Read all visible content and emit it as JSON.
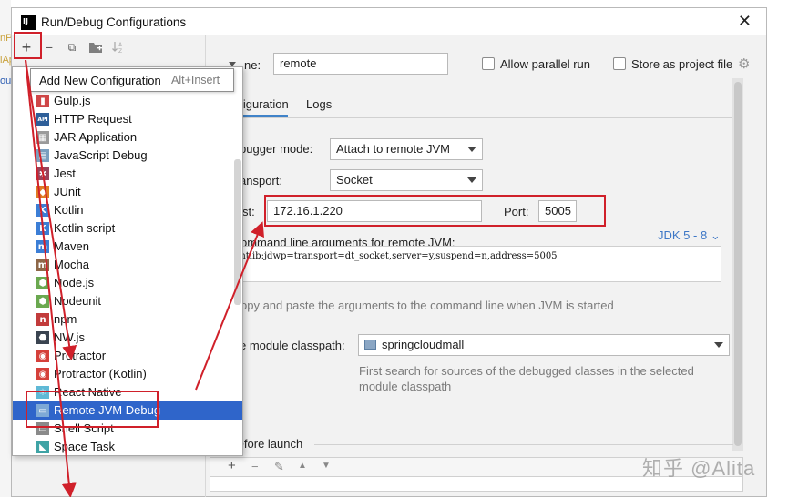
{
  "window": {
    "title": "Run/Debug Configurations",
    "close": "✕"
  },
  "edge_text": [
    "nPo",
    "lAp",
    "oul"
  ],
  "toolbar": {
    "add": "+",
    "remove": "−",
    "copy": "⧉",
    "folder": "▸",
    "sort": "↓"
  },
  "tooltip": {
    "title": "Add New Configuration",
    "shortcut": "Alt+Insert"
  },
  "config_types": [
    {
      "label": "Gulp.js",
      "icon": "gulp-icon",
      "icon_char": "▮",
      "color": "#cf4647"
    },
    {
      "label": "HTTP Request",
      "icon": "api-icon",
      "icon_char": "API",
      "color": "#2e5f99"
    },
    {
      "label": "JAR Application",
      "icon": "jar-icon",
      "icon_char": "▦",
      "color": "#9a9a9a"
    },
    {
      "label": "JavaScript Debug",
      "icon": "js-debug-icon",
      "icon_char": "▤",
      "color": "#7a9fbf"
    },
    {
      "label": "Jest",
      "icon": "jest-icon",
      "icon_char": "✱",
      "color": "#99425b"
    },
    {
      "label": "JUnit",
      "icon": "junit-icon",
      "icon_char": "◆",
      "color": "#e07b22"
    },
    {
      "label": "Kotlin",
      "icon": "kotlin-icon",
      "icon_char": "K",
      "color": "#3b7ed6"
    },
    {
      "label": "Kotlin script",
      "icon": "kotlin-script-icon",
      "icon_char": "K",
      "color": "#3b7ed6"
    },
    {
      "label": "Maven",
      "icon": "maven-icon",
      "icon_char": "m",
      "color": "#3b7ed6"
    },
    {
      "label": "Mocha",
      "icon": "mocha-icon",
      "icon_char": "m",
      "color": "#8d6748"
    },
    {
      "label": "Node.js",
      "icon": "nodejs-icon",
      "icon_char": "⬢",
      "color": "#6aa84f"
    },
    {
      "label": "Nodeunit",
      "icon": "nodeunit-icon",
      "icon_char": "⬢",
      "color": "#6aa84f"
    },
    {
      "label": "npm",
      "icon": "npm-icon",
      "icon_char": "n",
      "color": "#c23b3b"
    },
    {
      "label": "NW.js",
      "icon": "nwjs-icon",
      "icon_char": "⬣",
      "color": "#3a4450"
    },
    {
      "label": "Protractor",
      "icon": "protractor-icon",
      "icon_char": "◉",
      "color": "#d5403a"
    },
    {
      "label": "Protractor (Kotlin)",
      "icon": "protractor-kotlin-icon",
      "icon_char": "◉",
      "color": "#d5403a"
    },
    {
      "label": "React Native",
      "icon": "react-native-icon",
      "icon_char": "⚛",
      "color": "#5fb9d6"
    },
    {
      "label": "Remote JVM Debug",
      "icon": "remote-debug-icon",
      "icon_char": "▭",
      "color": "#7ea9d6"
    },
    {
      "label": "Shell Script",
      "icon": "shell-icon",
      "icon_char": "▭",
      "color": "#8a8a8a"
    },
    {
      "label": "Space Task",
      "icon": "space-icon",
      "icon_char": "◣",
      "color": "#3ea3a5"
    }
  ],
  "selected_index": 17,
  "form": {
    "name_label": "ne:",
    "name_value": "remote",
    "allow_parallel": "Allow parallel run",
    "store_as_project": "Store as project file",
    "tab_configuration": "nfiguration",
    "tab_logs": "Logs",
    "debugger_mode_label": "bugger mode:",
    "debugger_mode_value": "Attach to remote JVM",
    "transport_label": "ansport:",
    "transport_value": "Socket",
    "host_label": "st:",
    "host_value": "172.16.1.220",
    "port_label": "Port:",
    "port_value": "5005",
    "cmd_label": "ommand line arguments for remote JVM:",
    "jdk_label": "JDK 5 - 8",
    "jdk_caret": "⌄",
    "args_value": "gentlib:jdwp=transport=dt_socket,server=y,suspend=n,address=5005",
    "copy_hint": "opy and paste the arguments to the command line when JVM is started",
    "module_label": "e module classpath:",
    "module_value": "springcloudmall",
    "module_hint_1": "First search for sources of the debugged classes in the selected",
    "module_hint_2": "module classpath",
    "before_launch": "Before launch",
    "bl_add": "+",
    "bl_remove": "−",
    "bl_edit": "✎",
    "bl_up": "▲",
    "bl_down": "▼"
  },
  "watermark": "知乎 @Alita",
  "colors": {
    "highlight": "#d0202a",
    "selection": "#2f65ca",
    "link": "#3d77c6",
    "tab_underline": "#4083c9"
  }
}
